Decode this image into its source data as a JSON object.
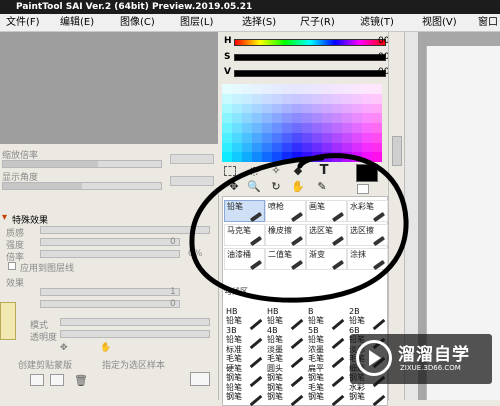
{
  "window": {
    "title": "PaintTool SAI Ver.2 (64bit) Preview.2019.05.21"
  },
  "menu": {
    "items": [
      "文件(F)",
      "编辑(E)",
      "图像(C)",
      "图层(L)",
      "选择(S)",
      "尺子(R)",
      "滤镜(T)",
      "视图(V)",
      "窗口"
    ]
  },
  "navigator": {
    "zoom_label": "缩放倍率",
    "angle_label": "显示角度"
  },
  "effects": {
    "header": "特殊效果",
    "texture_label": "质感",
    "strength_label": "强度",
    "strength_value": "0",
    "scale_label": "倍率",
    "scale_value": "0%",
    "apply_to_layer_label": "应用到图层线",
    "effect_label": "效果",
    "effect_value_1": "1",
    "effect_value_2": "0",
    "mode_label": "模式",
    "opacity_label": "透明度",
    "clipping_label": "创建剪贴蒙版",
    "specify_sample_label": "指定为选区样本"
  },
  "color": {
    "h_label": "H",
    "h_value": "000",
    "s_label": "S",
    "s_value": "000",
    "v_label": "V",
    "v_value": "000",
    "primary_color": "#000000",
    "secondary_color": "#ffffff"
  },
  "tools": {
    "text_glyph": "T"
  },
  "brushes": {
    "cells": [
      "铅笔",
      "喷枪",
      "画笔",
      "水彩笔",
      "马克笔",
      "橡皮擦",
      "选区笔",
      "选区擦",
      "油漆桶",
      "二值笔",
      "渐变",
      "涂抹"
    ],
    "edge_tool": "勾线区"
  },
  "sizes": {
    "cells": [
      [
        "HB",
        "铅笔"
      ],
      [
        "HB",
        "铅笔"
      ],
      [
        "B",
        "铅笔"
      ],
      [
        "2B",
        "铅笔"
      ],
      [
        "3B",
        "铅笔"
      ],
      [
        "4B",
        "铅笔"
      ],
      [
        "5B",
        "铅笔"
      ],
      [
        "6B",
        "铅笔"
      ],
      [
        "标准",
        "毛笔"
      ],
      [
        "淡墨",
        "毛笔"
      ],
      [
        "浓墨",
        "毛笔"
      ],
      [
        "淡彩",
        "毛笔"
      ],
      [
        "硬笔",
        "钢笔"
      ],
      [
        "圆头",
        "钢笔"
      ],
      [
        "扁平",
        "钢笔"
      ],
      [
        "细线",
        "钢笔"
      ],
      [
        "铅笔",
        "钢笔"
      ],
      [
        "钢笔",
        "钢笔"
      ],
      [
        "毛笔",
        "钢笔"
      ],
      [
        "水彩",
        "钢笔"
      ]
    ]
  },
  "watermark": {
    "title": "溜溜自学",
    "subtitle": "ZIXUE.3D66.COM"
  }
}
